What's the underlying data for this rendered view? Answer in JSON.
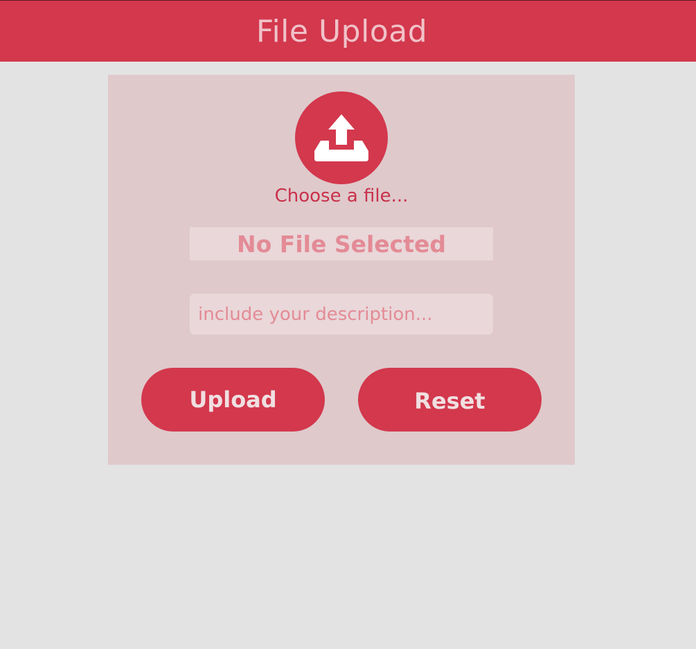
{
  "header": {
    "title": "File Upload"
  },
  "uploader": {
    "icon": "upload-tray-icon",
    "choose_label": "Choose a file...",
    "file_status": "No File Selected",
    "description_placeholder": "include your description...",
    "description_value": ""
  },
  "actions": {
    "upload_label": "Upload",
    "reset_label": "Reset"
  },
  "colors": {
    "accent": "#d3384d",
    "page_background": "#e3e3e3",
    "card_background": "#dfc9cb",
    "field_background": "#e9d7d9",
    "muted_text": "#e38b96"
  }
}
